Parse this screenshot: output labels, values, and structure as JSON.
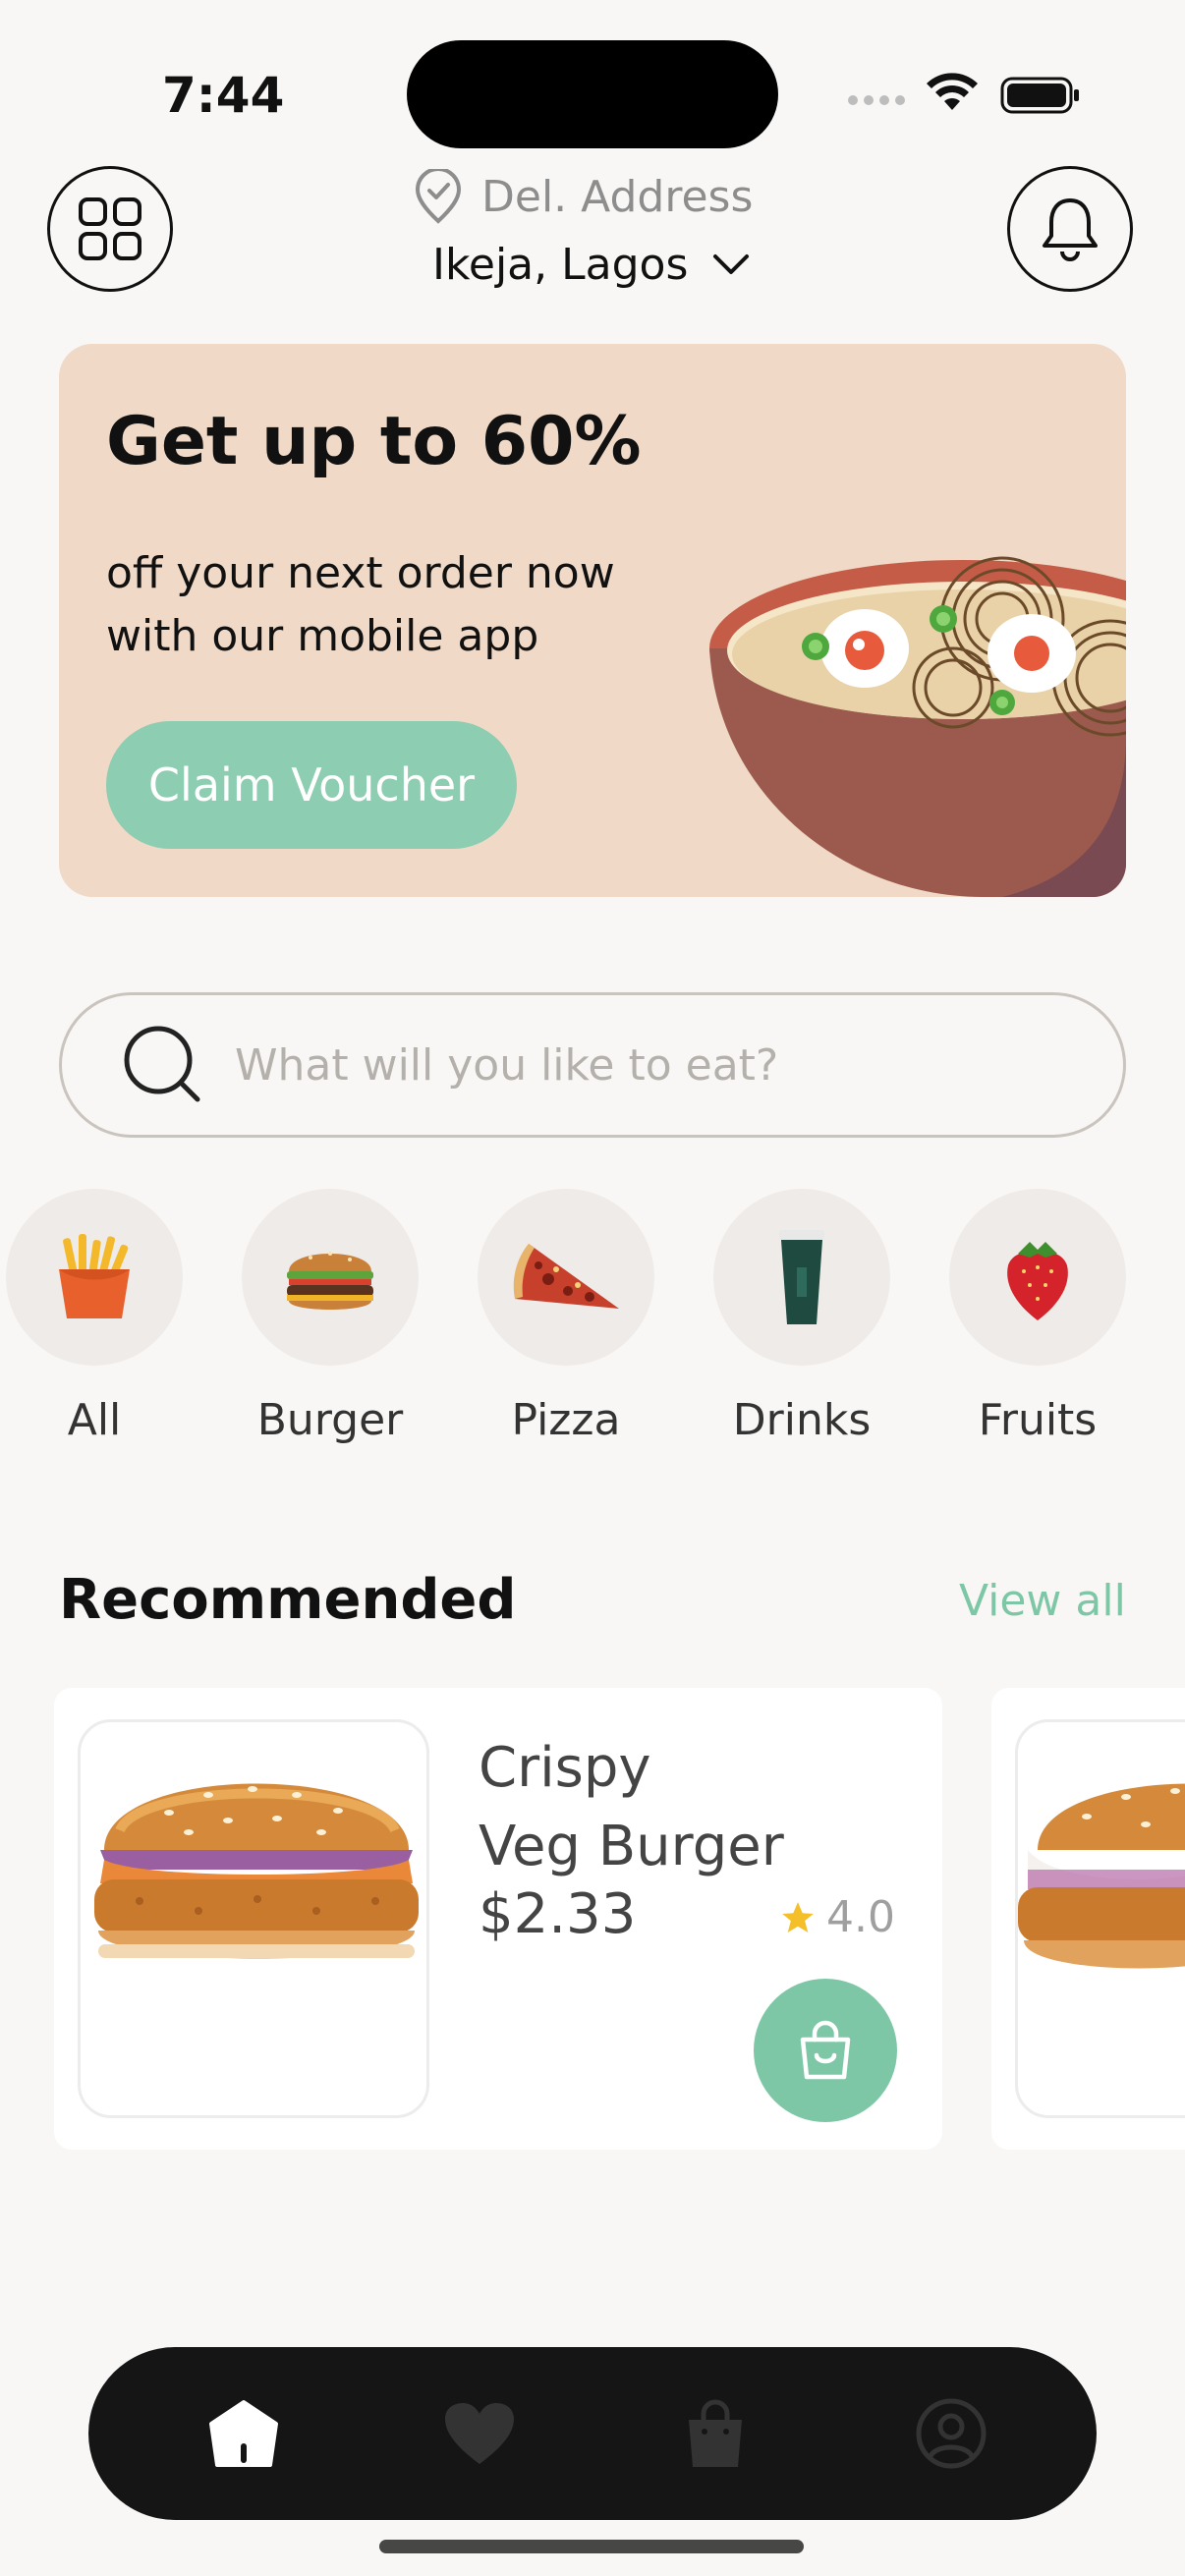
{
  "status_bar": {
    "time": "7:44"
  },
  "header": {
    "address_label": "Del. Address",
    "address_value": "Ikeja, Lagos",
    "icons": {
      "menu": "grid-icon",
      "location": "location-pin-icon",
      "dropdown": "chevron-down-icon",
      "notifications": "bell-icon"
    }
  },
  "promo": {
    "title": "Get up to 60%",
    "subtitle_line1": "off your next order now",
    "subtitle_line2": "with our mobile app",
    "cta_label": "Claim Voucher",
    "colors": {
      "background": "#f0d9c6",
      "cta": "#8dcdb1"
    }
  },
  "search": {
    "placeholder": "What will you like to eat?",
    "value": ""
  },
  "categories": [
    {
      "label": "All",
      "icon": "fries-icon"
    },
    {
      "label": "Burger",
      "icon": "burger-icon"
    },
    {
      "label": "Pizza",
      "icon": "pizza-slice-icon"
    },
    {
      "label": "Drinks",
      "icon": "cup-icon"
    },
    {
      "label": "Fruits",
      "icon": "strawberry-icon"
    }
  ],
  "recommended": {
    "title": "Recommended",
    "view_all_label": "View all",
    "items": [
      {
        "name_line1": "Crispy",
        "name_line2": "Veg Burger",
        "price": "$2.33",
        "rating": "4.0"
      }
    ]
  },
  "bottom_nav": {
    "items": [
      {
        "name": "home-icon",
        "active": true
      },
      {
        "name": "heart-icon",
        "active": false
      },
      {
        "name": "bag-icon",
        "active": false
      },
      {
        "name": "profile-icon",
        "active": false
      }
    ]
  },
  "colors": {
    "accent": "#7dc7a6",
    "star": "#f5bf2a",
    "page_bg": "#f9f7f5"
  }
}
